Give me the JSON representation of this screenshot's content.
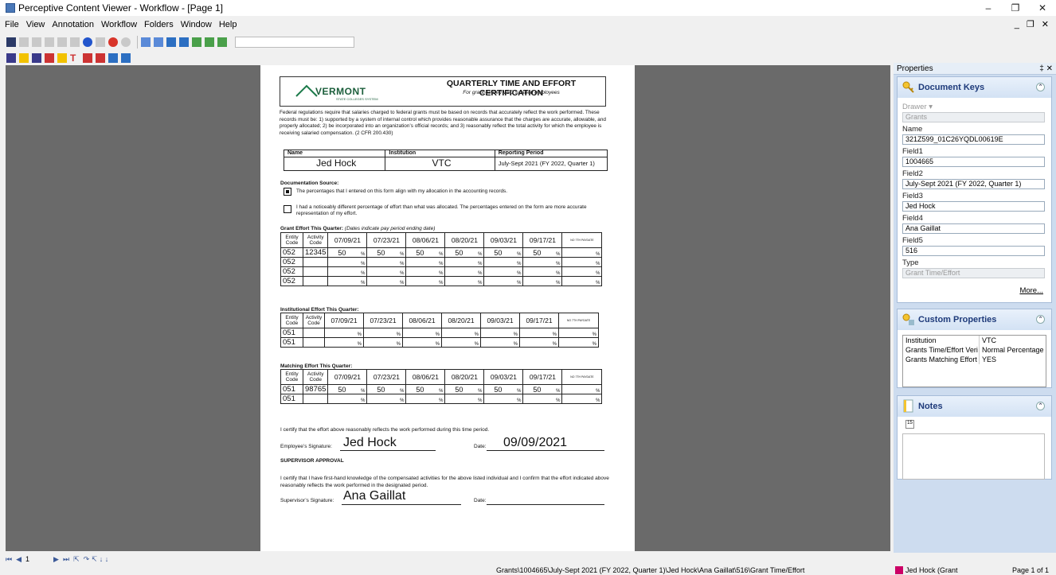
{
  "window": {
    "title": "Perceptive Content Viewer - Workflow - [Page 1]",
    "controls": [
      "–",
      "❐",
      "✕"
    ],
    "mdi_controls": "_ ❐ ✕"
  },
  "menu": [
    "File",
    "View",
    "Annotation",
    "Workflow",
    "Folders",
    "Window",
    "Help"
  ],
  "properties": {
    "title": "Properties",
    "pin": "‡ ✕",
    "document_keys": {
      "title": "Document Keys",
      "drawer_label": "Drawer",
      "drawer_value": "Grants",
      "fields": [
        {
          "label": "Name",
          "value": "321Z599_01C26YQDL00619E"
        },
        {
          "label": "Field1",
          "value": "1004665"
        },
        {
          "label": "Field2",
          "value": "July-Sept 2021 (FY 2022, Quarter 1)"
        },
        {
          "label": "Field3",
          "value": "Jed Hock"
        },
        {
          "label": "Field4",
          "value": "Ana Gaillat"
        },
        {
          "label": "Field5",
          "value": "516"
        }
      ],
      "type_label": "Type",
      "type_value": "Grant Time/Effort",
      "more": "More..."
    },
    "custom": {
      "title": "Custom Properties",
      "rows": [
        {
          "k": "Institution",
          "v": "VTC"
        },
        {
          "k": "Grants Time/Effort Veri",
          "v": "Normal Percentage"
        },
        {
          "k": "Grants Matching Effort",
          "v": "YES"
        }
      ]
    },
    "notes": {
      "title": "Notes"
    }
  },
  "status": {
    "path": "Grants\\1004665\\July-Sept 2021 (FY 2022, Quarter 1)\\Jed Hock\\Ana Gaillat\\516\\Grant Time/Effort",
    "user": "Jed Hock (Grant",
    "page": "Page 1 of 1",
    "nav_page": "1"
  },
  "doc": {
    "logo": "VERMONT",
    "logo_sub": "STATE COLLEGES SYSTEM",
    "title": "QUARTERLY TIME AND EFFORT CERTIFICATION",
    "subtitle": "For grant-funded VSC salaried employees",
    "intro": "Federal regulations require that salaries charged to federal grants must be based on records that accurately reflect the work performed. These records must be: 1) supported by a system of internal control which provides reasonable assurance that the charges are accurate, allowable, and properly allocated; 2) be incorporated into an organization’s official records; and 3) reasonably reflect the total activity for which the employee is receiving salaried compensation.  (2 CFR 200.430)",
    "hdr_name": "Name",
    "hdr_inst": "Institution",
    "hdr_period": "Reporting Period",
    "name": "Jed Hock",
    "inst": "VTC",
    "period": "July-Sept 2021 (FY 2022, Quarter 1)",
    "doc_source": "Documentation Source:",
    "opt1": "The percentages that I entered on this form align with my allocation in the accounting records.",
    "opt2": "I had a noticeably different percentage of effort than what was allocated. The percentages entered on the form are more accurate representation of my effort.",
    "grant_title": "Grant Effort This Quarter:",
    "grant_note": "(Dates indicate pay period ending date)",
    "inst_title": "Institutional Effort This Quarter:",
    "match_title": "Matching Effort This Quarter:",
    "col_entity": "Entity Code",
    "col_activity": "Activity Code",
    "dates": [
      "07/09/21",
      "07/23/21",
      "08/06/21",
      "08/20/21",
      "09/03/21",
      "09/17/21"
    ],
    "last_col": "NO 7TH PAYDATE",
    "pct": "%",
    "grant_rows": [
      {
        "e": "052",
        "a": "12345",
        "v": [
          "50",
          "50",
          "50",
          "50",
          "50",
          "50",
          ""
        ]
      },
      {
        "e": "052",
        "a": "",
        "v": [
          "",
          "",
          "",
          "",
          "",
          "",
          ""
        ]
      },
      {
        "e": "052",
        "a": "",
        "v": [
          "",
          "",
          "",
          "",
          "",
          "",
          ""
        ]
      },
      {
        "e": "052",
        "a": "",
        "v": [
          "",
          "",
          "",
          "",
          "",
          "",
          ""
        ]
      }
    ],
    "inst_rows": [
      {
        "e": "051",
        "a": "",
        "v": [
          "",
          "",
          "",
          "",
          "",
          "",
          ""
        ]
      },
      {
        "e": "051",
        "a": "",
        "v": [
          "",
          "",
          "",
          "",
          "",
          "",
          ""
        ]
      }
    ],
    "match_rows": [
      {
        "e": "051",
        "a": "98765",
        "v": [
          "50",
          "50",
          "50",
          "50",
          "50",
          "50",
          ""
        ]
      },
      {
        "e": "051",
        "a": "",
        "v": [
          "",
          "",
          "",
          "",
          "",
          "",
          ""
        ]
      }
    ],
    "certify": "I certify that the effort above reasonably reflects the work performed during this time period.",
    "emp_sig_label": "Employee’s Signature:",
    "emp_sig": "Jed Hock",
    "date_label": "Date:",
    "emp_date": "09/09/2021",
    "sup_title": "SUPERVISOR APPROVAL",
    "sup_text": "I certify that I have first-hand knowledge of the compensated activities for the above listed individual and I confirm that the effort indicated above reasonably reflects the work performed in the designated period.",
    "sup_sig_label": "Supervisor’s Signature:",
    "sup_sig": "Ana Gaillat"
  }
}
